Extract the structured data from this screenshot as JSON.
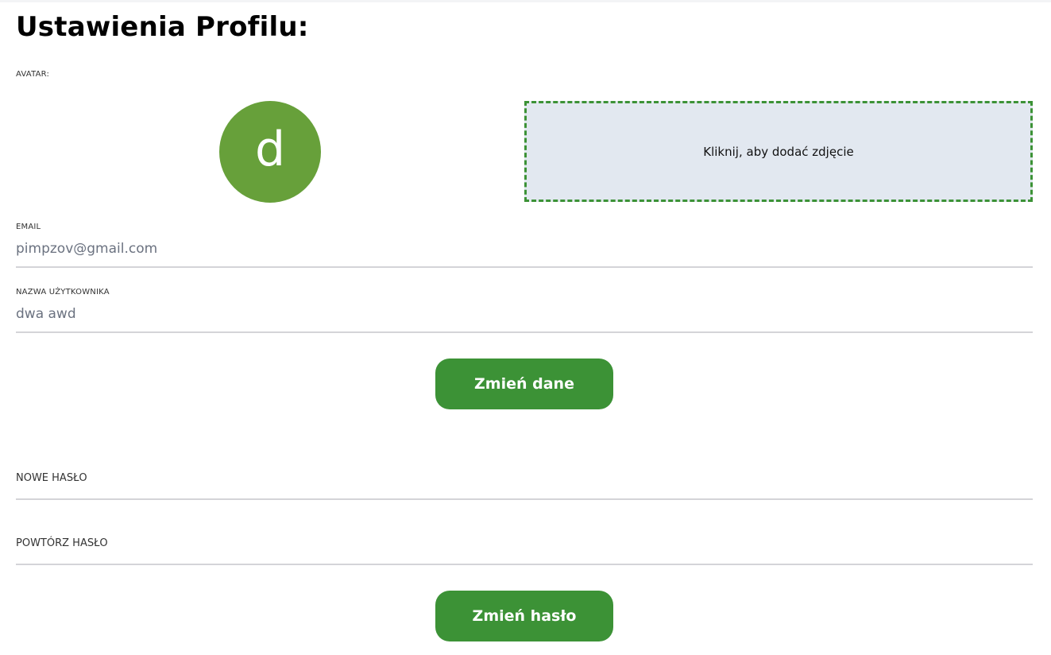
{
  "page": {
    "title": "Ustawienia Profilu:"
  },
  "avatar": {
    "label": "AVATAR:",
    "initial": "d",
    "color": "#67a03a",
    "upload_prompt": "Kliknij, aby dodać zdjęcie"
  },
  "profile_form": {
    "email_label": "EMAIL",
    "email_value": "pimpzov@gmail.com",
    "username_label": "NAZWA UŻYTKOWNIKA",
    "username_value": "dwa awd",
    "submit_label": "Zmień dane"
  },
  "password_form": {
    "new_password_label": "NOWE HASŁO",
    "repeat_password_label": "POWTÓRZ HASŁO",
    "submit_label": "Zmień hasło"
  },
  "colors": {
    "accent": "#3c9236",
    "dropzone_bg": "#e2e8f0",
    "underline": "#d4d4d8"
  }
}
